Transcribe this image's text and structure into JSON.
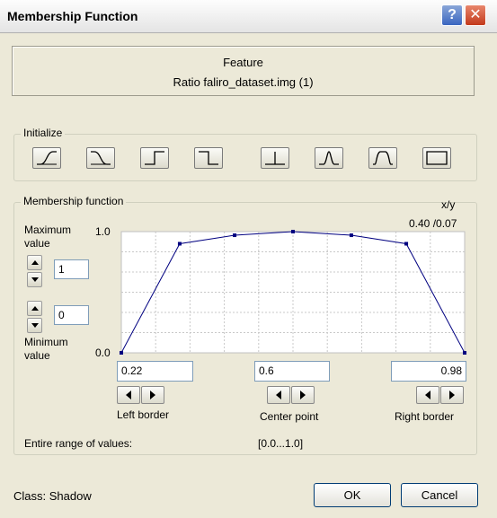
{
  "window": {
    "title": "Membership Function"
  },
  "titlebar": {
    "help_symbol": "?",
    "close_symbol": "✕"
  },
  "feature": {
    "heading": "Feature",
    "name": "Ratio faliro_dataset.img (1)"
  },
  "initialize": {
    "label": "Initialize",
    "buttons": [
      {
        "icon": "rising-s-curve-icon"
      },
      {
        "icon": "falling-s-curve-icon"
      },
      {
        "icon": "rising-step-icon"
      },
      {
        "icon": "falling-step-icon"
      },
      {
        "icon": "single-value-icon"
      },
      {
        "icon": "triangle-icon"
      },
      {
        "icon": "trapezoid-icon"
      },
      {
        "icon": "full-range-icon"
      }
    ]
  },
  "membership": {
    "label": "Membership function",
    "xy_label": "x/y",
    "xy_value": "0.40 /0.07",
    "max_label_line1": "Maximum",
    "max_label_line2": "value",
    "max_value": "1",
    "min_label_line1": "Minimum",
    "min_label_line2": "value",
    "min_value": "0",
    "range_label": "Entire range of values:",
    "range_value": "[0.0...1.0]"
  },
  "chart_data": {
    "type": "line",
    "xlim": [
      0.0,
      1.0
    ],
    "ylim": [
      0.0,
      1.0
    ],
    "y_tick_labels": [
      "1.0",
      "0.0"
    ],
    "grid": true,
    "line_color": "#000080",
    "series": [
      {
        "x": [
          0.0,
          0.17,
          0.33,
          0.5,
          0.67,
          0.83,
          1.0
        ],
        "y": [
          0.0,
          0.9,
          0.97,
          1.0,
          0.97,
          0.9,
          0.0
        ]
      }
    ]
  },
  "borders": {
    "left": {
      "value": "0.22",
      "label": "Left border"
    },
    "center": {
      "value": "0.6",
      "label": "Center point"
    },
    "right": {
      "value": "0.98",
      "label": "Right border"
    }
  },
  "footer": {
    "class_label": "Class: Shadow",
    "ok": "OK",
    "cancel": "Cancel"
  }
}
